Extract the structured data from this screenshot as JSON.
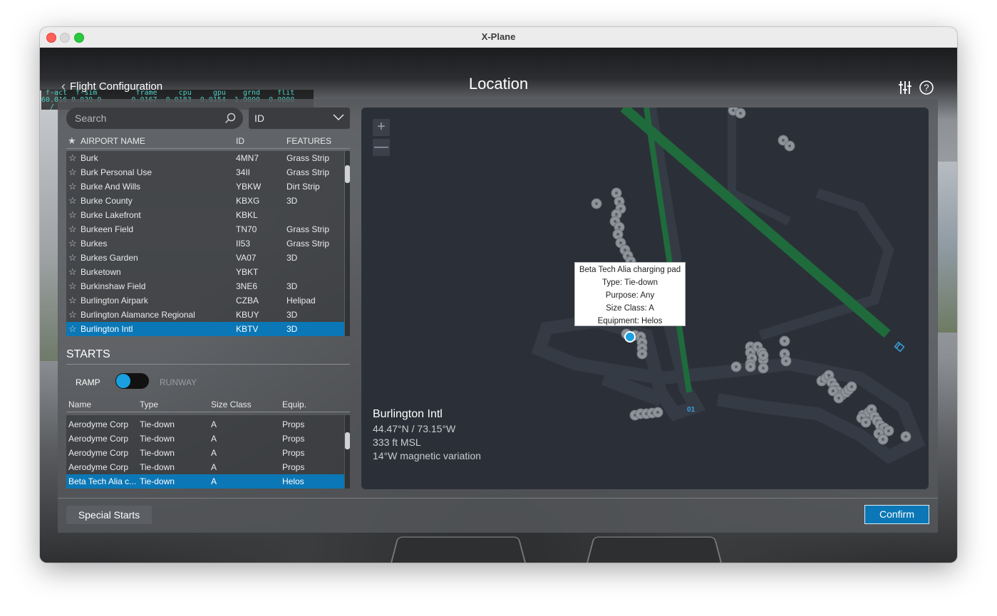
{
  "window": {
    "title": "X-Plane"
  },
  "hud": {
    "line1": " f-act  f-sim         frame     cpu     gpu    grnd    flit",
    "line2": "60.016 0.039.0       0.0167  0.0183  0.0154  1.0000  0.0000",
    "line3": "  /"
  },
  "header": {
    "back_label": "Flight Configuration",
    "title": "Location",
    "settings_icon": "sliders-icon",
    "help_icon": "question-circle-icon"
  },
  "search": {
    "placeholder": "Search",
    "filter_value": "ID"
  },
  "airports": {
    "columns": [
      "AIRPORT NAME",
      "ID",
      "FEATURES"
    ],
    "rows": [
      {
        "name": "Burk",
        "id": "4MN7",
        "features": "Grass Strip"
      },
      {
        "name": "Burk Personal Use",
        "id": "34II",
        "features": "Grass Strip"
      },
      {
        "name": "Burke And Wills",
        "id": "YBKW",
        "features": "Dirt Strip"
      },
      {
        "name": "Burke County",
        "id": "KBXG",
        "features": "3D"
      },
      {
        "name": "Burke Lakefront",
        "id": "KBKL",
        "features": ""
      },
      {
        "name": "Burkeen Field",
        "id": "TN70",
        "features": "Grass Strip"
      },
      {
        "name": "Burkes",
        "id": "II53",
        "features": "Grass Strip"
      },
      {
        "name": "Burkes Garden",
        "id": "VA07",
        "features": "3D"
      },
      {
        "name": "Burketown",
        "id": "YBKT",
        "features": ""
      },
      {
        "name": "Burkinshaw Field",
        "id": "3NE6",
        "features": "3D"
      },
      {
        "name": "Burlington Airpark",
        "id": "CZBA",
        "features": "Helipad"
      },
      {
        "name": "Burlington Alamance Regional",
        "id": "KBUY",
        "features": "3D"
      },
      {
        "name": "Burlington Intl",
        "id": "KBTV",
        "features": "3D",
        "selected": true
      }
    ]
  },
  "starts": {
    "title": "STARTS",
    "toggle_left": "RAMP",
    "toggle_right": "RUNWAY",
    "columns": [
      "Name",
      "Type",
      "Size Class",
      "Equip."
    ],
    "rows": [
      {
        "name": "Aerodyme Corp",
        "type": "Tie-down",
        "size": "A",
        "equip": "Props"
      },
      {
        "name": "Aerodyme Corp",
        "type": "Tie-down",
        "size": "A",
        "equip": "Props"
      },
      {
        "name": "Aerodyme Corp",
        "type": "Tie-down",
        "size": "A",
        "equip": "Props"
      },
      {
        "name": "Aerodyme Corp",
        "type": "Tie-down",
        "size": "A",
        "equip": "Props"
      },
      {
        "name": "Beta Tech Alia c...",
        "type": "Tie-down",
        "size": "A",
        "equip": "Helos",
        "selected": true
      }
    ]
  },
  "map": {
    "zoom_in": "+",
    "zoom_out": "—",
    "tooltip": {
      "title": "Beta Tech Alia charging pad",
      "type": "Type: Tie-down",
      "purpose": "Purpose: Any",
      "size": "Size Class: A",
      "equipment": "Equipment: Helos"
    },
    "runway_label": "01",
    "info": {
      "name": "Burlington Intl",
      "coords": "44.47°N / 73.15°W",
      "elevation": "333 ft MSL",
      "variation": "14°W magnetic variation"
    },
    "colors": {
      "runway": "#1f6b3c",
      "selected": "#1aa0e0",
      "spot": "#8e939a"
    }
  },
  "footer": {
    "special_starts": "Special Starts",
    "confirm": "Confirm"
  }
}
